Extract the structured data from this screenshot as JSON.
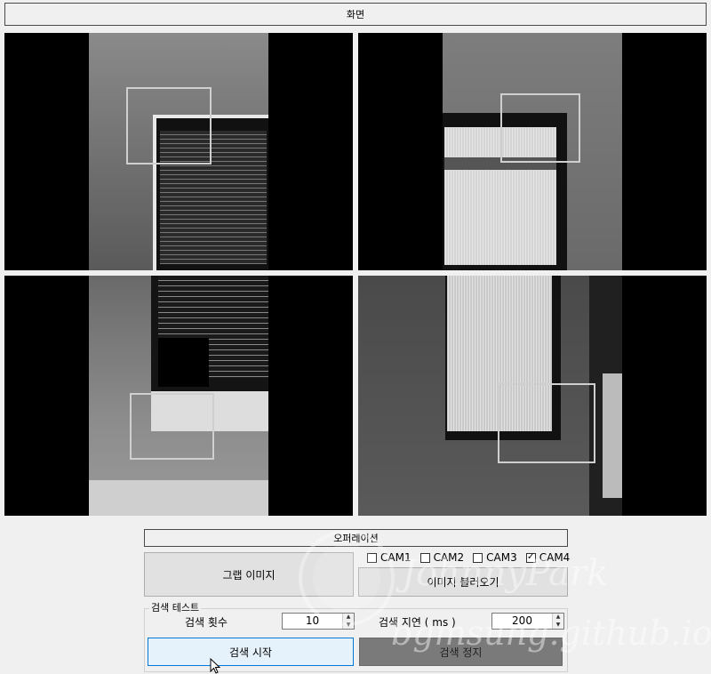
{
  "screen_panel": {
    "title": "화면"
  },
  "cameras": [
    {
      "id": "cam1-view",
      "roi": true
    },
    {
      "id": "cam2-view",
      "roi": true
    },
    {
      "id": "cam3-view",
      "roi": true
    },
    {
      "id": "cam4-view",
      "roi": true
    }
  ],
  "operation_panel": {
    "title": "오퍼레이션",
    "grab_button": "그랩 이미지",
    "load_button": "이미지 불러오기",
    "cams": [
      {
        "label": "CAM1",
        "checked": false
      },
      {
        "label": "CAM2",
        "checked": false
      },
      {
        "label": "CAM3",
        "checked": false
      },
      {
        "label": "CAM4",
        "checked": true
      }
    ],
    "search_test": {
      "title": "검색 테스트",
      "count_label": "검색 횟수",
      "count_value": "10",
      "delay_label": "검색 지연 ( ms )",
      "delay_value": "200",
      "start_button": "검색 시작",
      "stop_button": "검색 정지"
    }
  },
  "watermark": {
    "line1": "JohnnyPark",
    "line2": "bgmsung.github.io"
  }
}
